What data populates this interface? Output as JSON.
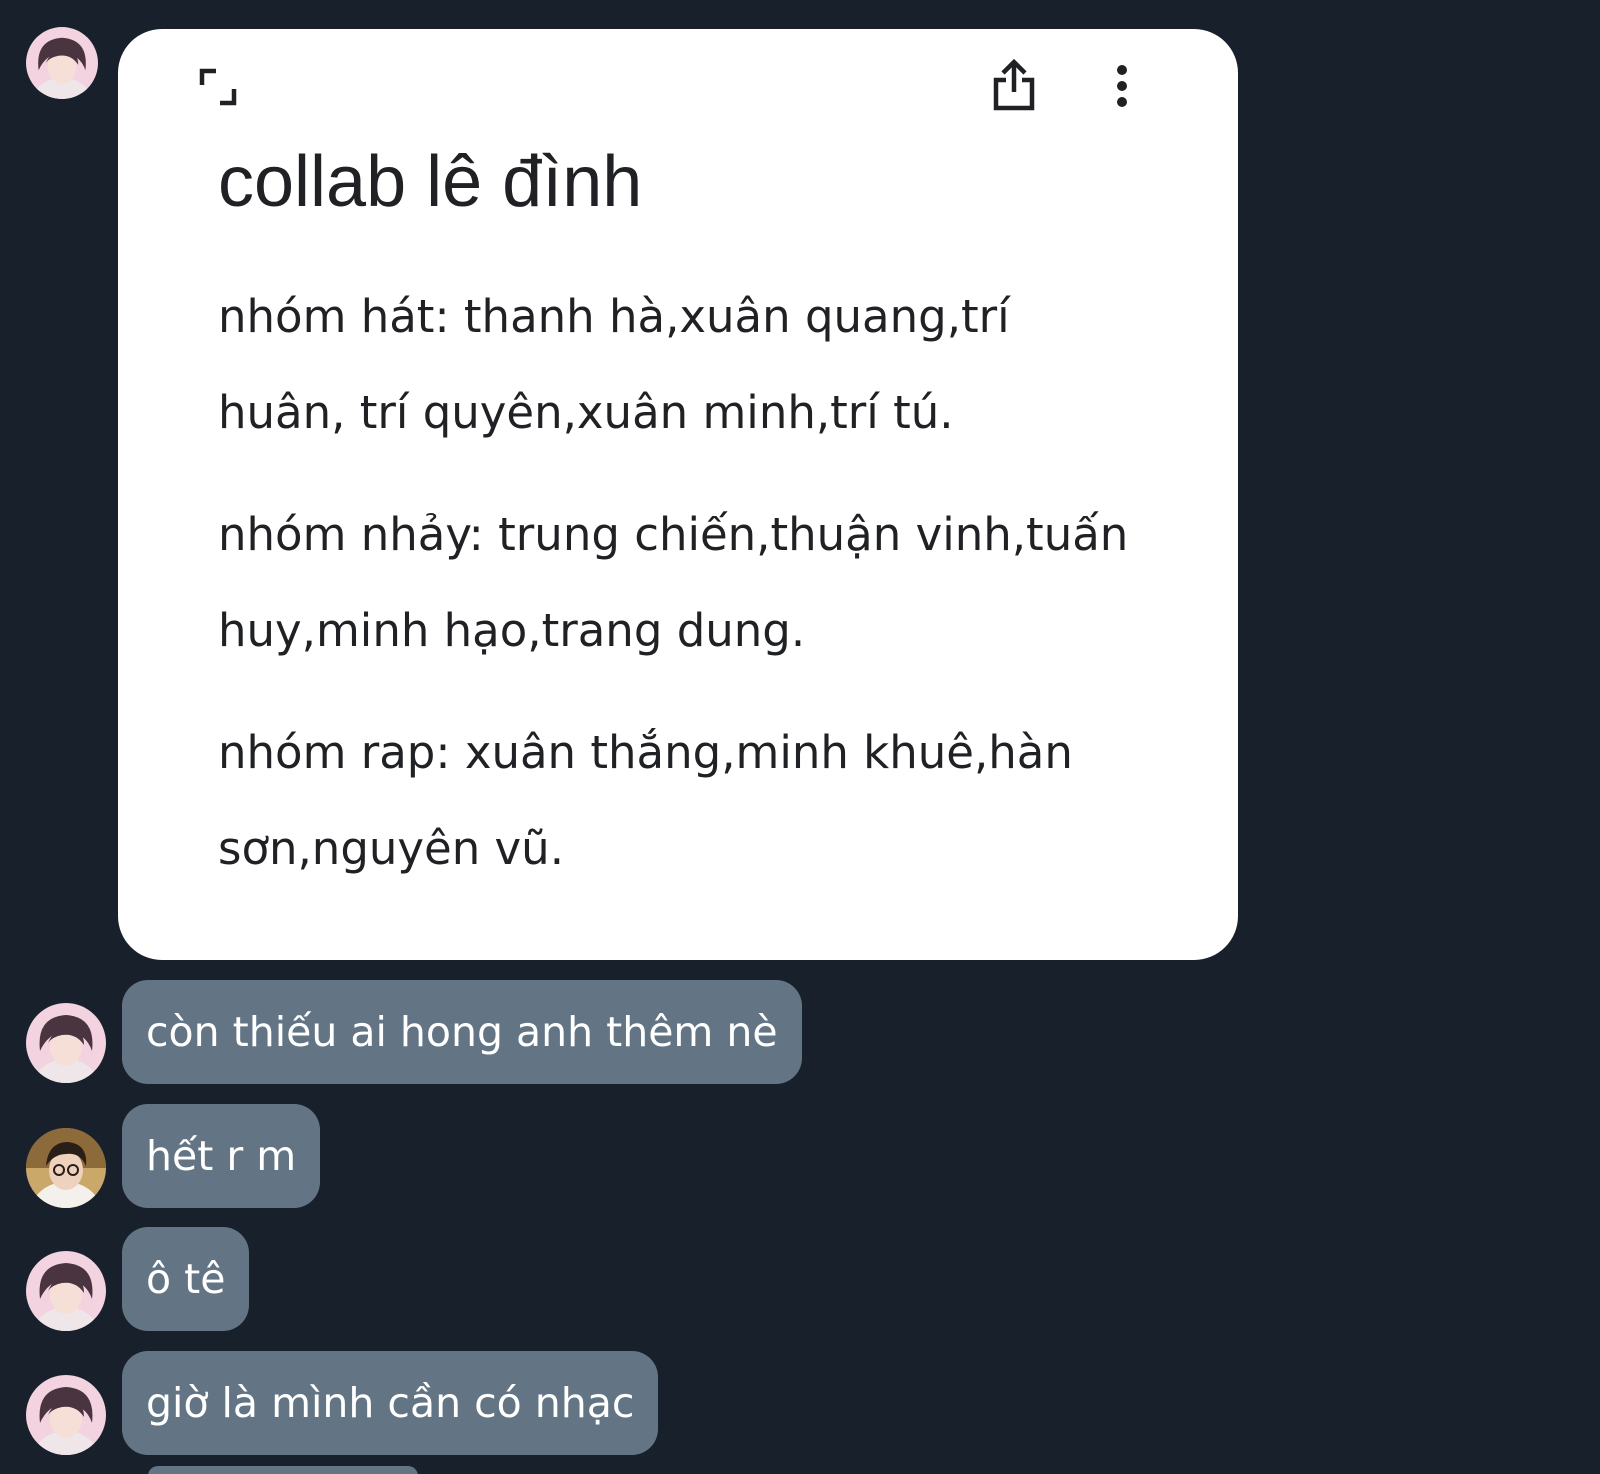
{
  "note": {
    "title": "collab lê đình",
    "paragraphs": [
      "nhóm hát: thanh hà,xuân quang,trí huân, trí quyên,xuân minh,trí tú.",
      "nhóm nhảy: trung chiến,thuận vinh,tuấn huy,minh hạo,trang dung.",
      "nhóm rap: xuân thắng,minh khuê,hàn sơn,nguyên vũ."
    ],
    "icons": [
      "expand-icon",
      "share-icon",
      "more-vert-icon"
    ]
  },
  "messages": [
    {
      "sender": "girl-avatar",
      "text": "còn thiếu ai hong anh thêm nè"
    },
    {
      "sender": "boy-avatar",
      "text": "hết r m"
    },
    {
      "sender": "girl-avatar",
      "text": "ô tê"
    },
    {
      "sender": "girl-avatar",
      "text": "giờ là mình cần có nhạc"
    }
  ],
  "colors": {
    "background": "#18202b",
    "bubble": "#637585",
    "card": "#ffffff"
  }
}
